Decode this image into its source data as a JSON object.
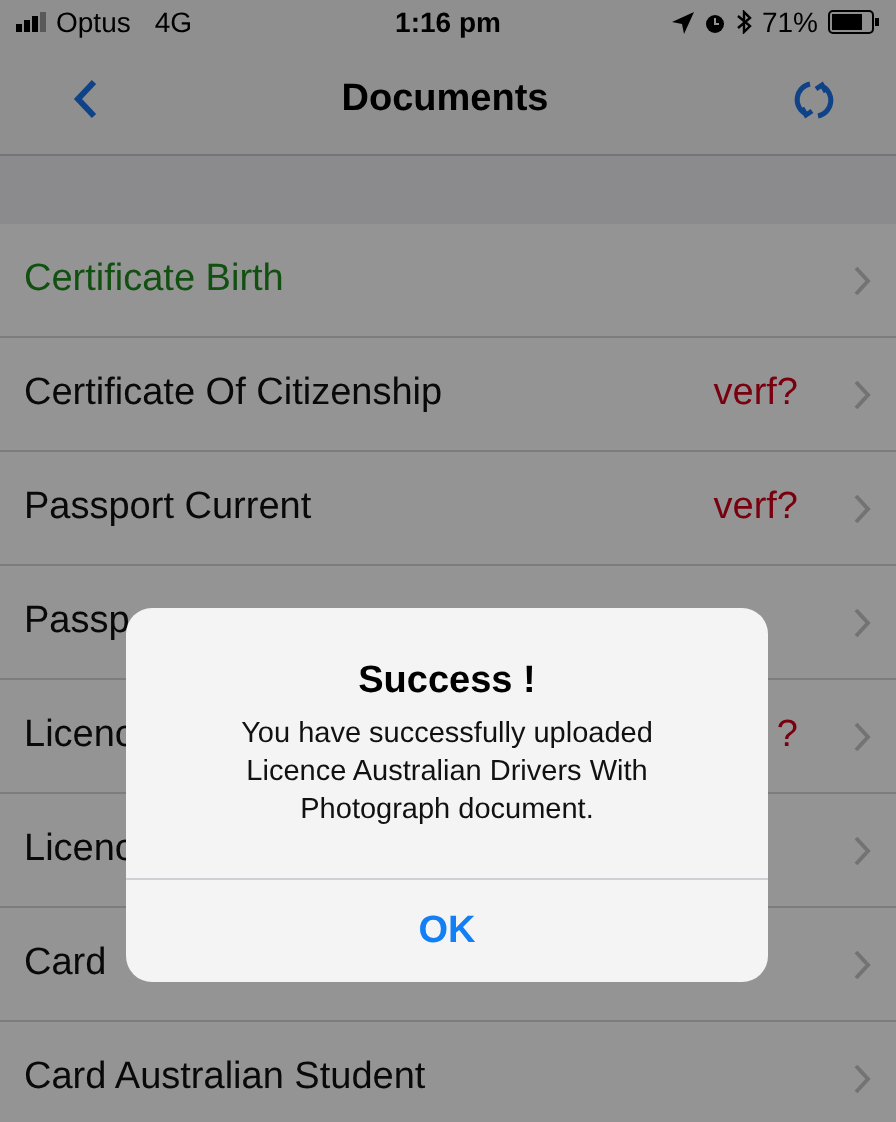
{
  "status_bar": {
    "carrier": "Optus",
    "network": "4G",
    "time": "1:16 pm",
    "battery": "71%"
  },
  "nav": {
    "title": "Documents"
  },
  "rows": [
    {
      "label": "Certificate Birth",
      "uploaded": true
    },
    {
      "label": "Certificate Of Citizenship",
      "uploaded": false,
      "badge": "verf?"
    },
    {
      "label": "Passport Current",
      "uploaded": false,
      "badge": "verf?"
    },
    {
      "label": "Passp",
      "uploaded": false
    },
    {
      "label": "Licenc",
      "uploaded": false,
      "badge": "?"
    },
    {
      "label": "Licenc",
      "uploaded": false
    },
    {
      "label": "Card",
      "uploaded": false
    },
    {
      "label": "Card Australian Student",
      "uploaded": false
    }
  ],
  "alert": {
    "title": "Success !",
    "message": "You have successfully uploaded Licence Australian Drivers With Photograph document.",
    "button": "OK"
  }
}
